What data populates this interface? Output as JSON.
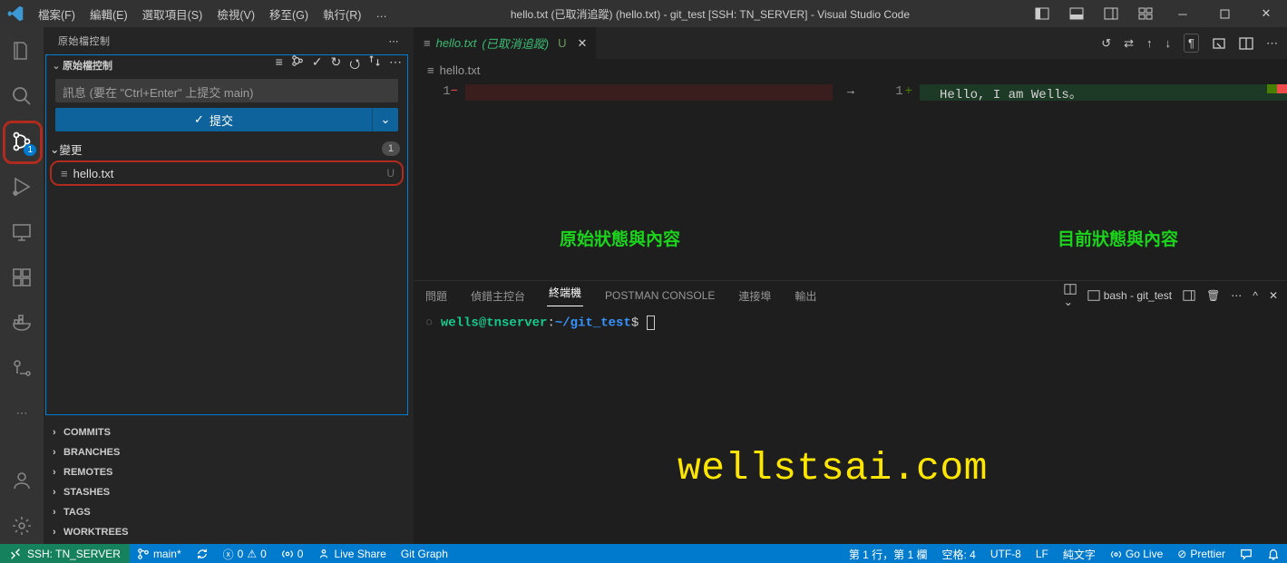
{
  "menu": {
    "file": "檔案(F)",
    "edit": "編輯(E)",
    "selection": "選取項目(S)",
    "view": "檢視(V)",
    "go": "移至(G)",
    "run": "執行(R)",
    "more": "…"
  },
  "window_title": "hello.txt (已取消追蹤) (hello.txt) - git_test [SSH: TN_SERVER] - Visual Studio Code",
  "sidebar": {
    "title": "原始檔控制",
    "section_label": "原始檔控制",
    "commit_placeholder": "訊息 (要在 \"Ctrl+Enter\" 上提交 main)",
    "commit_button": "提交",
    "changes_label": "變更",
    "changes_count": "1",
    "file": {
      "name": "hello.txt",
      "status": "U"
    },
    "groups": [
      "COMMITS",
      "BRANCHES",
      "REMOTES",
      "STASHES",
      "TAGS",
      "WORKTREES"
    ]
  },
  "scm_badge": "1",
  "tab": {
    "name": "hello.txt",
    "suffix": "(已取消追蹤)",
    "status": "U"
  },
  "crumb": "hello.txt",
  "diff": {
    "left_line_no": "1",
    "right_line_no": "1",
    "code": "Hello, I am Wells。",
    "overlay_left": "原始狀態與內容",
    "overlay_right": "目前狀態與內容"
  },
  "panel": {
    "tabs": {
      "problems": "問題",
      "debug": "偵錯主控台",
      "terminal": "終端機",
      "postman": "POSTMAN CONSOLE",
      "ports": "連接埠",
      "output": "輸出"
    },
    "shell_label": "bash - git_test",
    "prompt_user": "wells@tnserver",
    "prompt_path": "~/git_test",
    "prompt_sym": "$"
  },
  "watermark": "wellstsai.com",
  "status": {
    "remote": "SSH: TN_SERVER",
    "branch": "main*",
    "errors": "0",
    "warnings": "0",
    "ports": "0",
    "liveshare": "Live Share",
    "gitgraph": "Git Graph",
    "cursor": "第 1 行，第 1 欄",
    "spaces": "空格: 4",
    "encoding": "UTF-8",
    "eol": "LF",
    "lang": "純文字",
    "golive": "Go Live",
    "prettier": "Prettier"
  }
}
